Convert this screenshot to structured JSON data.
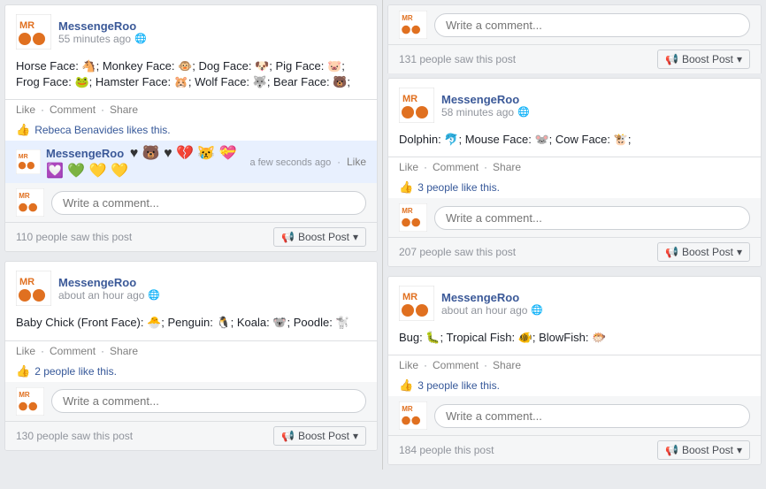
{
  "posts": [
    {
      "id": "post1",
      "column": 0,
      "author": "MessengeRoo",
      "time": "55 minutes ago",
      "body": "Horse Face: 🐴; Monkey Face: 🐵; Dog Face: 🐶; Pig Face: 🐷; Frog Face: 🐸; Hamster Face: 🐹; Wolf Face: 🐺; Bear Face: 🐻;",
      "actions": [
        "Like",
        "Comment",
        "Share"
      ],
      "likes_text": "Rebeca Benavides likes this.",
      "saw_count": "110 people saw this post",
      "boost_label": "Boost Post",
      "comment_placeholder": "Write a comment...",
      "has_reaction": true,
      "reaction_bar": "♥ 🐻 ♥ 💔 😿 💝 💟 💚 💛 💛",
      "reaction_time": "a few seconds ago",
      "reaction_actor": "MessengeRoo",
      "reaction_like": "Like"
    },
    {
      "id": "post2",
      "column": 0,
      "author": "MessengeRoo",
      "time": "about an hour ago",
      "body": "Baby Chick (Front Face): 🐣; Penguin: 🐧; Koala: 🐨; Poodle: 🐩",
      "actions": [
        "Like",
        "Comment",
        "Share"
      ],
      "likes_text": "2 people like this.",
      "saw_count": "130 people saw this post",
      "boost_label": "Boost Post",
      "comment_placeholder": "Write a comment..."
    },
    {
      "id": "post3",
      "column": 1,
      "author": "MessengeRoo",
      "time": "58 minutes ago",
      "body": "Dolphin: 🐬; Mouse Face: 🐭; Cow Face: 🐮;",
      "actions": [
        "Like",
        "Comment",
        "Share"
      ],
      "likes_text": "3 people like this.",
      "saw_count": "207 people saw this post",
      "boost_label": "Boost Post",
      "comment_placeholder": "Write a comment...",
      "top_comment_placeholder": "Write a comment...",
      "top_saw_count": "131 people saw this post"
    },
    {
      "id": "post4",
      "column": 1,
      "author": "MessengeRoo",
      "time": "about an hour ago",
      "body": "Bug: 🐛; Tropical Fish: 🐠; BlowFish: 🐡",
      "actions": [
        "Like",
        "Comment",
        "Share"
      ],
      "likes_text": "3 people like this.",
      "saw_count": "184 people this post",
      "boost_label": "Boost Post",
      "comment_placeholder": "Write a comment..."
    }
  ],
  "top_card": {
    "comment_placeholder": "Write a comment...",
    "saw_count": "131 people saw this post",
    "boost_label": "Boost Post"
  }
}
